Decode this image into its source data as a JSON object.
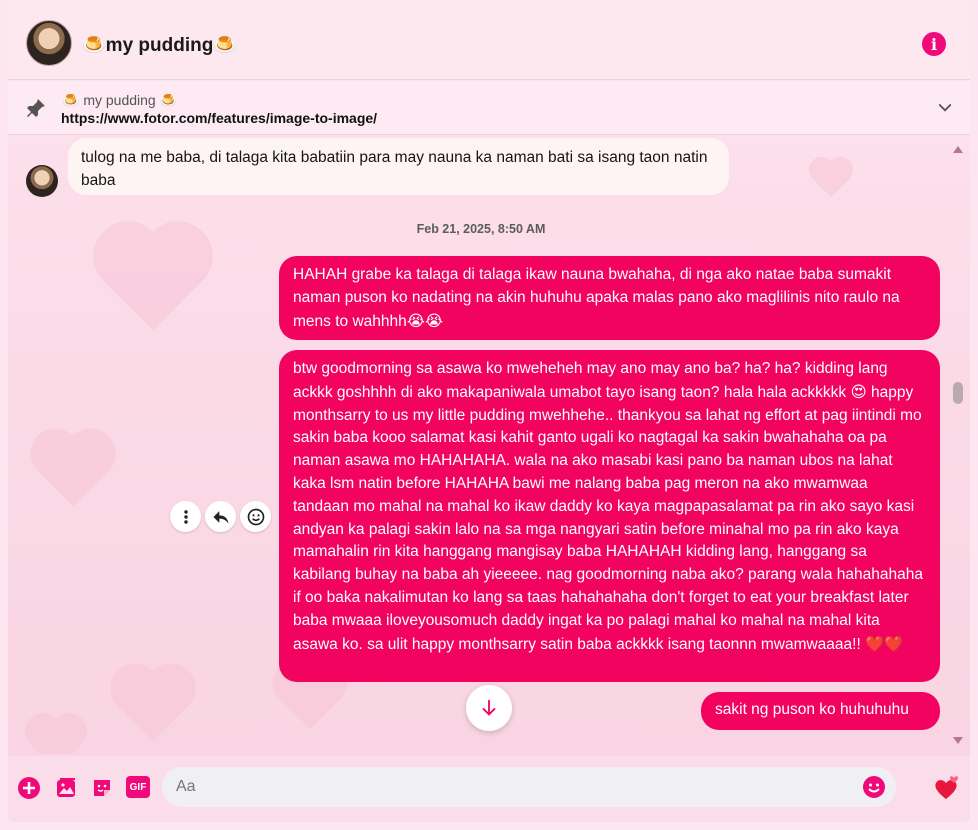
{
  "header": {
    "title": "my pudding",
    "title_emoji": "🍮"
  },
  "pinned": {
    "name": "my pudding",
    "name_emoji": "🍮",
    "url": "https://www.fotor.com/features/image-to-image/"
  },
  "messages": {
    "incoming_1": "tulog na me baba, di talaga kita babatiin para may nauna ka naman bati sa isang taon natin baba",
    "timestamp": "Feb 21, 2025, 8:50 AM",
    "outgoing_1": "HAHAH grabe ka talaga di talaga ikaw nauna bwahaha, di nga ako natae baba sumakit naman puson ko nadating na akin huhuhu apaka malas pano ako maglilinis nito raulo na mens to wahhhh",
    "outgoing_1_emoji": "😭😭",
    "outgoing_2a": "btw goodmorning sa asawa ko mweheheh may ano may ano ba? ha? ha? kidding lang ackkk goshhhh di ako makapaniwala umabot tayo isang taon? hala hala ackkkkk",
    "outgoing_2_emoji_a": "😍",
    "outgoing_2b": " happy monthsarry to us my little pudding mwehhehe.. thankyou sa lahat ng effort at pag iintindi mo sakin baba kooo salamat kasi kahit ganto ugali ko nagtagal ka sakin bwahahaha oa pa naman asawa mo HAHAHAHA. wala na ako masabi kasi pano ba naman ubos na lahat kaka lsm natin before HAHAHA bawi me nalang baba pag meron na ako mwamwaa tandaan mo mahal na mahal ko ikaw daddy ko kaya magpapasalamat pa rin ako sayo kasi andyan ka palagi sakin lalo na sa mga nangyari satin before minahal mo pa rin ako kaya mamahalin rin kita hanggang mangisay baba HAHAHAH kidding lang, hanggang sa kabilang buhay na baba ah yieeeee. nag goodmorning naba ako? parang wala hahahahaha if oo baka nakalimutan ko lang sa taas hahahahaha don't forget to eat your breakfast later baba mwaaa iloveyousomuch daddy ingat ka po palagi mahal ko mahal na mahal kita asawa ko. sa ulit happy monthsarry satin baba ackkkk isang taonnn mwamwaaaa!!",
    "outgoing_2_emoji_b": "❤️❤️",
    "outgoing_3": "sakit ng puson ko huhuhuhu"
  },
  "composer": {
    "placeholder": "Aa"
  },
  "icons": {
    "info": "info-icon",
    "pin": "pin-icon",
    "chevron": "chevron-down-icon",
    "more": "more-options-icon",
    "reply": "reply-icon",
    "react": "smiley-icon",
    "scroll": "arrow-down-icon",
    "add": "plus-circle-icon",
    "gallery": "image-icon",
    "sticker": "sticker-icon",
    "gif": "gif-icon",
    "emoji": "emoji-icon",
    "like": "heart-icon"
  },
  "colors": {
    "accent": "#f2035f",
    "icon": "#f0097a"
  },
  "labels": {
    "gif": "GIF",
    "info_glyph": "i"
  }
}
